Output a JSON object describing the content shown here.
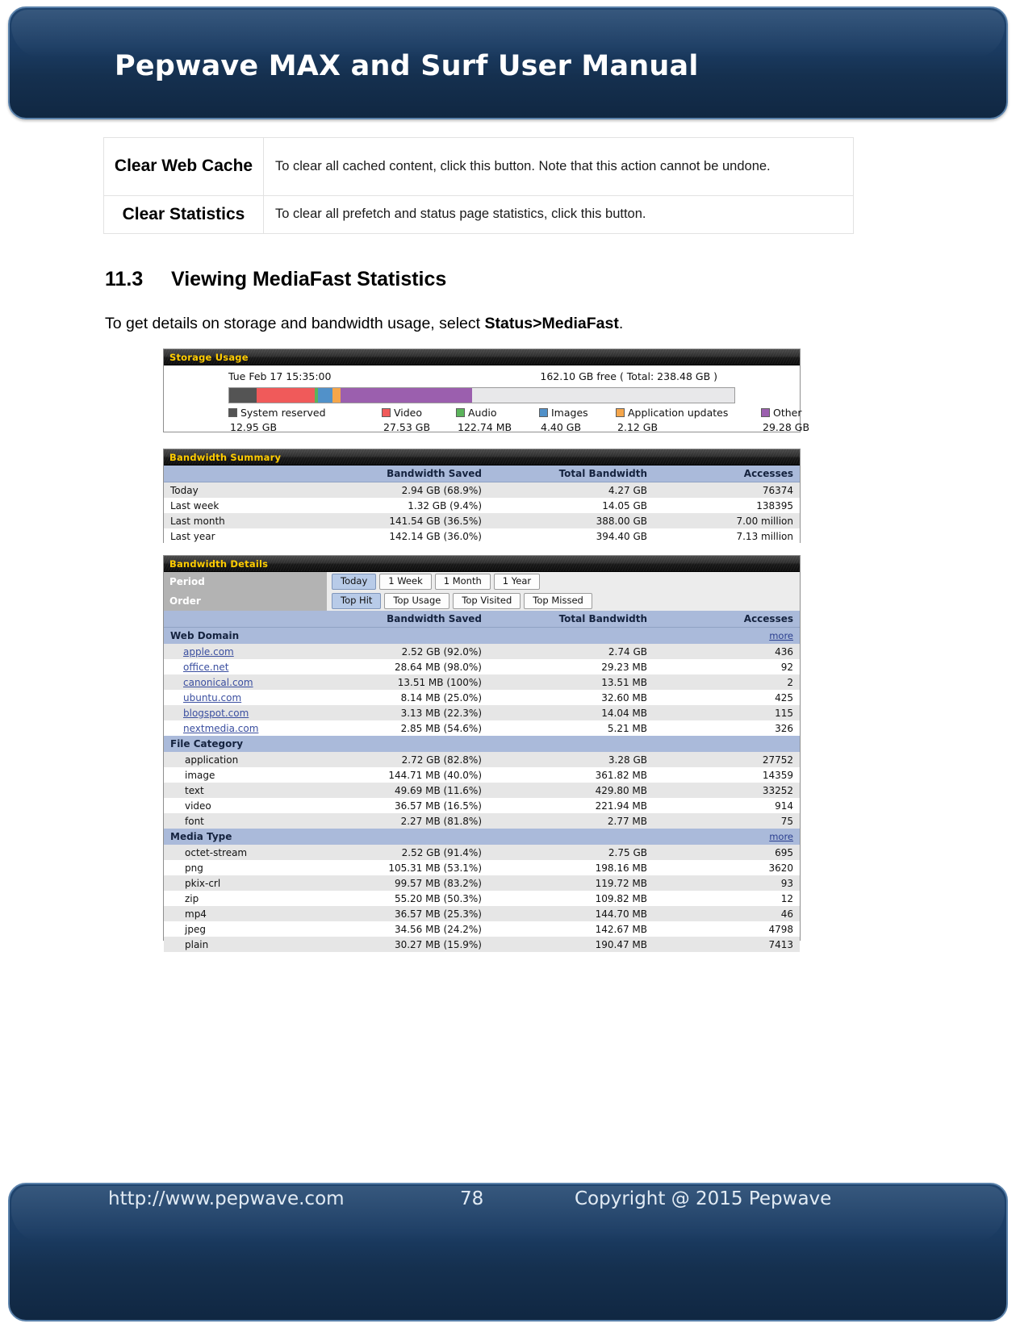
{
  "document": {
    "header_title": "Pepwave MAX and Surf User Manual",
    "footer": {
      "url": "http://www.pepwave.com",
      "page_number": "78",
      "copyright": "Copyright @ 2015 Pepwave"
    },
    "settings_table": {
      "rows": [
        {
          "label": "Clear Web Cache",
          "description": "To clear all cached content, click this button. Note that this action cannot be undone."
        },
        {
          "label": "Clear Statistics",
          "description": "To clear all prefetch and status page statistics, click this button."
        }
      ]
    },
    "section": {
      "number": "11.3",
      "title": "Viewing MediaFast Statistics",
      "lead_prefix": "To get details on storage and bandwidth usage, select ",
      "lead_bold": "Status>MediaFast",
      "lead_suffix": "."
    }
  },
  "storage_usage": {
    "panel_title": "Storage Usage",
    "timestamp": "Tue Feb 17 15:35:00",
    "free_text": "162.10 GB free ( Total: 238.48 GB )",
    "segments": [
      {
        "label": "System reserved",
        "value": "12.95 GB",
        "color": "#545454",
        "percent": 5.43
      },
      {
        "label": "Video",
        "value": "27.53 GB",
        "color": "#f05a5a",
        "percent": 11.54
      },
      {
        "label": "Audio",
        "value": "122.74 MB",
        "color": "#5bb45b",
        "percent": 0.55
      },
      {
        "label": "Images",
        "value": "4.40 GB",
        "color": "#5191c9",
        "percent": 2.9
      },
      {
        "label": "Application updates",
        "value": "2.12 GB",
        "color": "#f5a64b",
        "percent": 1.6
      },
      {
        "label": "Other",
        "value": "29.28 GB",
        "color": "#9b5fae",
        "percent": 26.0
      },
      {
        "label": "Free",
        "value": "162.10 GB",
        "color": "#e8e8ea",
        "percent": 51.98
      }
    ]
  },
  "bandwidth_summary": {
    "panel_title": "Bandwidth Summary",
    "columns": [
      "",
      "Bandwidth Saved",
      "Total Bandwidth",
      "Accesses"
    ],
    "rows": [
      {
        "period": "Today",
        "saved": "2.94 GB (68.9%)",
        "total": "4.27 GB",
        "accesses": "76374"
      },
      {
        "period": "Last week",
        "saved": "1.32 GB (9.4%)",
        "total": "14.05 GB",
        "accesses": "138395"
      },
      {
        "period": "Last month",
        "saved": "141.54 GB (36.5%)",
        "total": "388.00 GB",
        "accesses": "7.00 million"
      },
      {
        "period": "Last year",
        "saved": "142.14 GB (36.0%)",
        "total": "394.40 GB",
        "accesses": "7.13 million"
      }
    ]
  },
  "bandwidth_details": {
    "panel_title": "Bandwidth Details",
    "period_label": "Period",
    "order_label": "Order",
    "period_buttons": [
      {
        "label": "Today",
        "selected": true
      },
      {
        "label": "1 Week",
        "selected": false
      },
      {
        "label": "1 Month",
        "selected": false
      },
      {
        "label": "1 Year",
        "selected": false
      }
    ],
    "order_buttons": [
      {
        "label": "Top Hit",
        "selected": true
      },
      {
        "label": "Top Usage",
        "selected": false
      },
      {
        "label": "Top Visited",
        "selected": false
      },
      {
        "label": "Top Missed",
        "selected": false
      }
    ],
    "columns": [
      "",
      "Bandwidth Saved",
      "Total Bandwidth",
      "Accesses"
    ],
    "groups": [
      {
        "name": "Web Domain",
        "more_label": "more",
        "has_more": true,
        "link_rows": true,
        "rows": [
          {
            "name": "apple.com",
            "saved": "2.52 GB (92.0%)",
            "total": "2.74 GB",
            "accesses": "436"
          },
          {
            "name": "office.net",
            "saved": "28.64 MB (98.0%)",
            "total": "29.23 MB",
            "accesses": "92"
          },
          {
            "name": "canonical.com",
            "saved": "13.51 MB (100%)",
            "total": "13.51 MB",
            "accesses": "2"
          },
          {
            "name": "ubuntu.com",
            "saved": "8.14 MB (25.0%)",
            "total": "32.60 MB",
            "accesses": "425"
          },
          {
            "name": "blogspot.com",
            "saved": "3.13 MB (22.3%)",
            "total": "14.04 MB",
            "accesses": "115"
          },
          {
            "name": "nextmedia.com",
            "saved": "2.85 MB (54.6%)",
            "total": "5.21 MB",
            "accesses": "326"
          }
        ]
      },
      {
        "name": "File Category",
        "more_label": "",
        "has_more": false,
        "link_rows": false,
        "rows": [
          {
            "name": "application",
            "saved": "2.72 GB (82.8%)",
            "total": "3.28 GB",
            "accesses": "27752"
          },
          {
            "name": "image",
            "saved": "144.71 MB (40.0%)",
            "total": "361.82 MB",
            "accesses": "14359"
          },
          {
            "name": "text",
            "saved": "49.69 MB (11.6%)",
            "total": "429.80 MB",
            "accesses": "33252"
          },
          {
            "name": "video",
            "saved": "36.57 MB (16.5%)",
            "total": "221.94 MB",
            "accesses": "914"
          },
          {
            "name": "font",
            "saved": "2.27 MB (81.8%)",
            "total": "2.77 MB",
            "accesses": "75"
          }
        ]
      },
      {
        "name": "Media Type",
        "more_label": "more",
        "has_more": true,
        "link_rows": false,
        "rows": [
          {
            "name": "octet-stream",
            "saved": "2.52 GB (91.4%)",
            "total": "2.75 GB",
            "accesses": "695"
          },
          {
            "name": "png",
            "saved": "105.31 MB (53.1%)",
            "total": "198.16 MB",
            "accesses": "3620"
          },
          {
            "name": "pkix-crl",
            "saved": "99.57 MB (83.2%)",
            "total": "119.72 MB",
            "accesses": "93"
          },
          {
            "name": "zip",
            "saved": "55.20 MB (50.3%)",
            "total": "109.82 MB",
            "accesses": "12"
          },
          {
            "name": "mp4",
            "saved": "36.57 MB (25.3%)",
            "total": "144.70 MB",
            "accesses": "46"
          },
          {
            "name": "jpeg",
            "saved": "34.56 MB (24.2%)",
            "total": "142.67 MB",
            "accesses": "4798"
          },
          {
            "name": "plain",
            "saved": "30.27 MB (15.9%)",
            "total": "190.47 MB",
            "accesses": "7413"
          }
        ]
      }
    ]
  }
}
